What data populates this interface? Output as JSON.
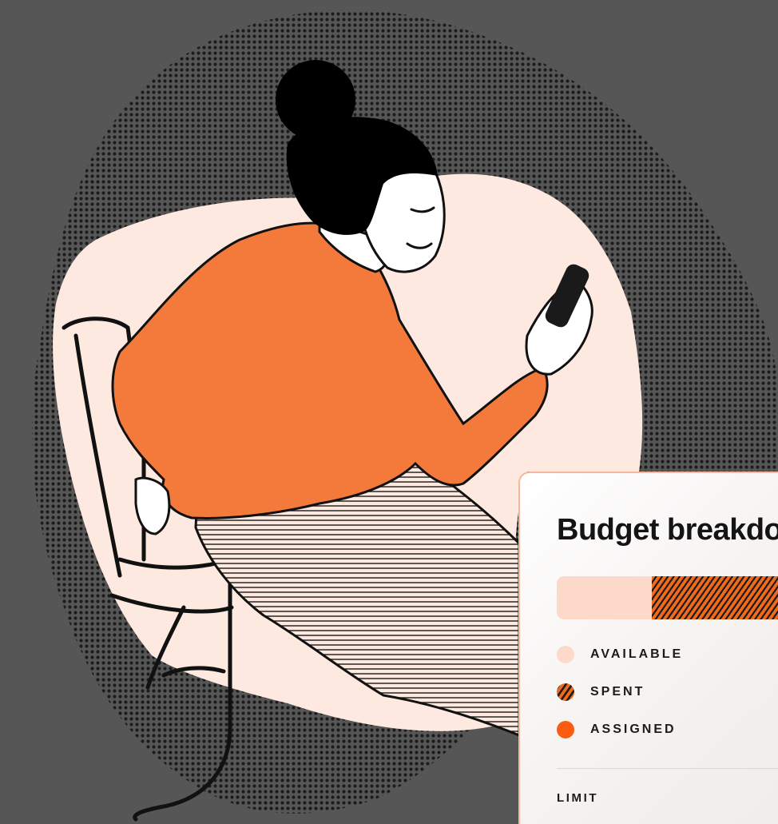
{
  "card": {
    "title": "Budget breakdown",
    "legend": [
      {
        "label": "AVAILABLE",
        "key": "available",
        "color": "#fcd9c8"
      },
      {
        "label": "SPENT",
        "key": "spent",
        "color": "#f06a1c"
      },
      {
        "label": "ASSIGNED",
        "key": "assigned",
        "color": "#fa5c12"
      }
    ],
    "limit_label": "LIMIT",
    "budget_fractions": {
      "available": 0.36,
      "spent": 0.64,
      "assigned": 0.0
    }
  },
  "colors": {
    "background": "#565656",
    "blob": "#fde9df",
    "accent_orange": "#fa5c12",
    "sweater": "#f47a3c",
    "card_border": "#f6b79a"
  }
}
